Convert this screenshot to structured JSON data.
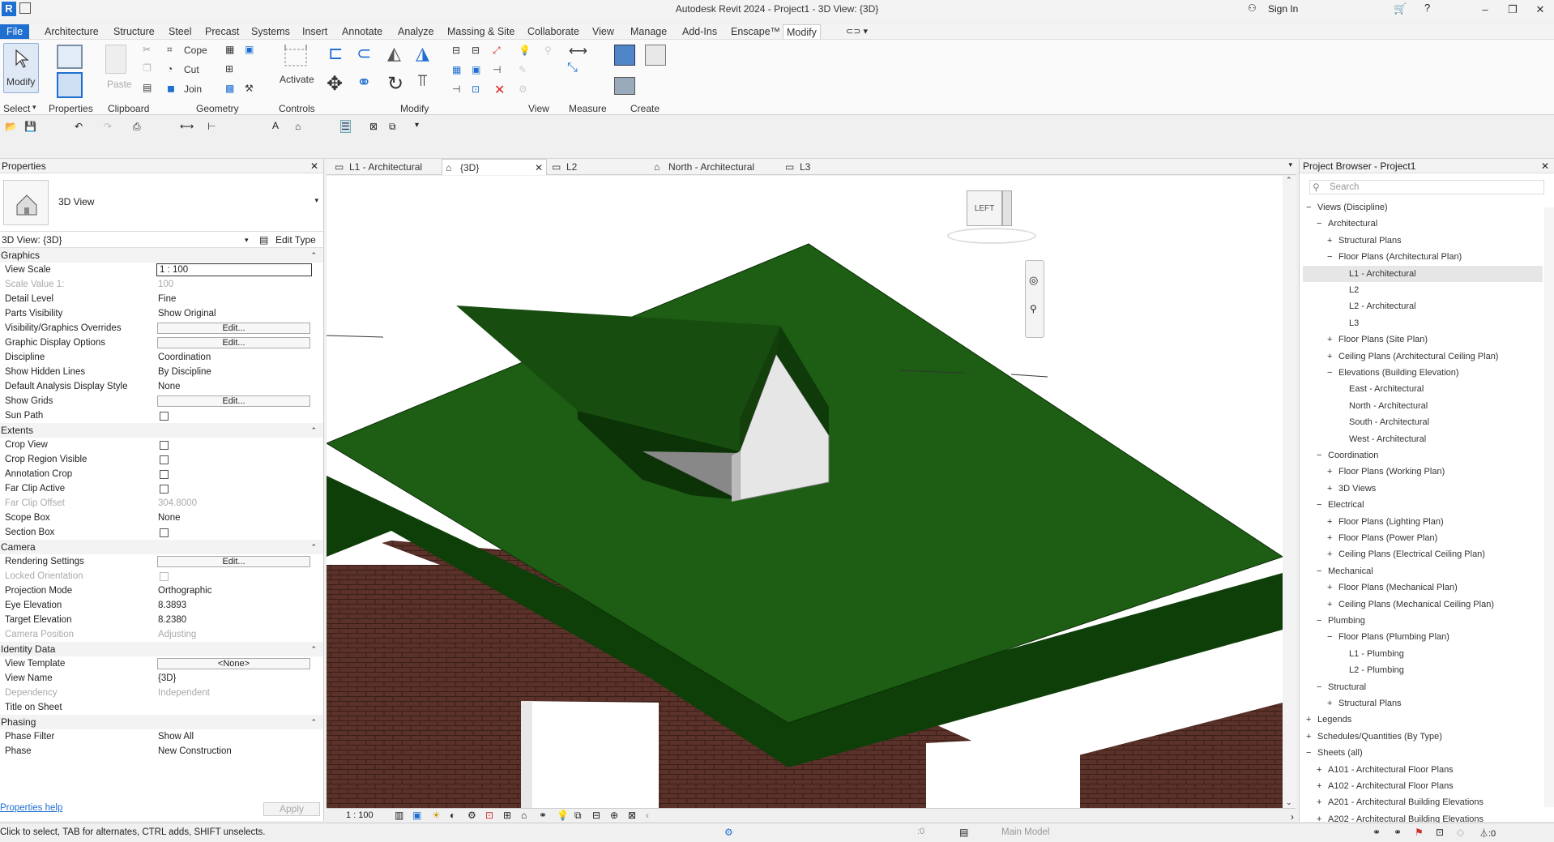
{
  "title": "Autodesk Revit 2024 - Project1 - 3D View: {3D}",
  "app_logo": "R",
  "signin": "Sign In",
  "menu_tabs": [
    "File",
    "Architecture",
    "Structure",
    "Steel",
    "Precast",
    "Systems",
    "Insert",
    "Annotate",
    "Analyze",
    "Massing & Site",
    "Collaborate",
    "View",
    "Manage",
    "Add-Ins",
    "Enscape™",
    "Modify"
  ],
  "ribbon": {
    "modify": "Modify",
    "paste": "Paste",
    "cope": "Cope",
    "cut": "Cut",
    "join": "Join",
    "activate": "Activate",
    "panels": [
      "Select",
      "Properties",
      "Clipboard",
      "Geometry",
      "Controls",
      "Modify",
      "View",
      "Measure",
      "Create"
    ]
  },
  "properties": {
    "header": "Properties",
    "type_name": "3D View",
    "selector": "3D View: {3D}",
    "edit_type": "Edit Type",
    "groups": {
      "graphics": "Graphics",
      "extents": "Extents",
      "camera": "Camera",
      "identity": "Identity Data",
      "phasing": "Phasing"
    },
    "rows": {
      "view_scale": [
        "View Scale",
        "1 : 100"
      ],
      "scale_value": [
        "Scale Value    1:",
        "100"
      ],
      "detail_level": [
        "Detail Level",
        "Fine"
      ],
      "parts_visibility": [
        "Parts Visibility",
        "Show Original"
      ],
      "vg_overrides": [
        "Visibility/Graphics Overrides",
        "Edit..."
      ],
      "graphic_display": [
        "Graphic Display Options",
        "Edit..."
      ],
      "discipline": [
        "Discipline",
        "Coordination"
      ],
      "hidden_lines": [
        "Show Hidden Lines",
        "By Discipline"
      ],
      "analysis_style": [
        "Default Analysis Display Style",
        "None"
      ],
      "show_grids": [
        "Show Grids",
        "Edit..."
      ],
      "sun_path": [
        "Sun Path",
        ""
      ],
      "crop_view": [
        "Crop View",
        ""
      ],
      "crop_region": [
        "Crop Region Visible",
        ""
      ],
      "annotation_crop": [
        "Annotation Crop",
        ""
      ],
      "far_clip_active": [
        "Far Clip Active",
        ""
      ],
      "far_clip_offset": [
        "Far Clip Offset",
        "304.8000"
      ],
      "scope_box": [
        "Scope Box",
        "None"
      ],
      "section_box": [
        "Section Box",
        ""
      ],
      "rendering": [
        "Rendering Settings",
        "Edit..."
      ],
      "locked_orientation": [
        "Locked Orientation",
        ""
      ],
      "projection": [
        "Projection Mode",
        "Orthographic"
      ],
      "eye_elev": [
        "Eye Elevation",
        "8.3893"
      ],
      "target_elev": [
        "Target Elevation",
        "8.2380"
      ],
      "camera_pos": [
        "Camera Position",
        "Adjusting"
      ],
      "view_template": [
        "View Template",
        "<None>"
      ],
      "view_name": [
        "View Name",
        "{3D}"
      ],
      "dependency": [
        "Dependency",
        "Independent"
      ],
      "title_on_sheet": [
        "Title on Sheet",
        ""
      ],
      "phase_filter": [
        "Phase Filter",
        "Show All"
      ],
      "phase": [
        "Phase",
        "New Construction"
      ]
    },
    "help": "Properties help",
    "apply": "Apply"
  },
  "view_tabs": [
    "L1 - Architectural",
    "{3D}",
    "L2",
    "North - Architectural",
    "L3"
  ],
  "viewcube_label": "LEFT",
  "view_scale": "1 : 100",
  "browser": {
    "header": "Project Browser - Project1",
    "search": "Search",
    "items": [
      "Views (Discipline)",
      "Architectural",
      "Structural Plans",
      "Floor Plans (Architectural Plan)",
      "L1 - Architectural",
      "L2",
      "L2 - Architectural",
      "L3",
      "Floor Plans (Site Plan)",
      "Ceiling Plans (Architectural Ceiling Plan)",
      "Elevations (Building Elevation)",
      "East - Architectural",
      "North - Architectural",
      "South - Architectural",
      "West - Architectural",
      "Coordination",
      "Floor Plans (Working Plan)",
      "3D Views",
      "Electrical",
      "Floor Plans (Lighting Plan)",
      "Floor Plans (Power Plan)",
      "Ceiling Plans (Electrical Ceiling Plan)",
      "Mechanical",
      "Floor Plans (Mechanical Plan)",
      "Ceiling Plans (Mechanical Ceiling Plan)",
      "Plumbing",
      "Floor Plans (Plumbing Plan)",
      "L1 - Plumbing",
      "L2 - Plumbing",
      "Structural",
      "Structural Plans",
      "Legends",
      "Schedules/Quantities (By Type)",
      "Sheets (all)",
      "A101 - Architectural Floor Plans",
      "A102 - Architectural Floor Plans",
      "A201 - Architectural Building Elevations",
      "A202 - Architectural Building Elevations"
    ]
  },
  "status": {
    "hint": "Click to select, TAB for alternates, CTRL adds, SHIFT unselects.",
    "coord": ":0",
    "model": "Main Model",
    "filter": ":0"
  },
  "colors": {
    "roof": "#1d5e14",
    "roof_dark": "#0f3f09",
    "brick": "#5a322a",
    "accent": "#1f6fd1"
  }
}
